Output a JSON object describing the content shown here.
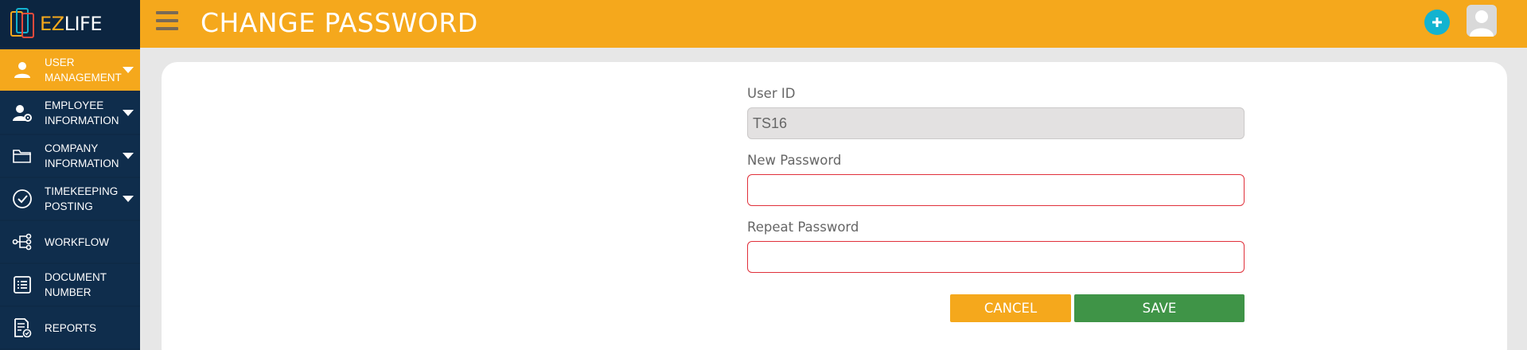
{
  "app": {
    "logo_text_accent": "EZ",
    "logo_text": "LIFE",
    "page_title": "CHANGE PASSWORD"
  },
  "sidebar": {
    "items": [
      {
        "label": "USER MANAGEMENT",
        "icon": "user-icon",
        "active": true,
        "has_caret": true
      },
      {
        "label": "EMPLOYEE INFORMATION",
        "icon": "user-gear-icon",
        "active": false,
        "has_caret": true
      },
      {
        "label": "COMPANY INFORMATION",
        "icon": "folder-icon",
        "active": false,
        "has_caret": true
      },
      {
        "label": "TIMEKEEPING POSTING",
        "icon": "check-circle-icon",
        "active": false,
        "has_caret": true
      },
      {
        "label": "WORKFLOW",
        "icon": "workflow-icon",
        "active": false,
        "has_caret": false
      },
      {
        "label": "DOCUMENT NUMBER",
        "icon": "document-list-icon",
        "active": false,
        "has_caret": false
      },
      {
        "label": "REPORTS",
        "icon": "report-icon",
        "active": false,
        "has_caret": false
      }
    ]
  },
  "form": {
    "user_id_label": "User ID",
    "user_id_value": "TS16",
    "new_password_label": "New Password",
    "new_password_value": "",
    "repeat_password_label": "Repeat Password",
    "repeat_password_value": "",
    "cancel_label": "CANCEL",
    "save_label": "SAVE"
  },
  "colors": {
    "header": "#f5a81c",
    "sidebar": "#0e2a47",
    "add_button": "#13b3d0",
    "save_button": "#3f9447",
    "cancel_button": "#f5a81c",
    "invalid_border": "#e0303a"
  }
}
